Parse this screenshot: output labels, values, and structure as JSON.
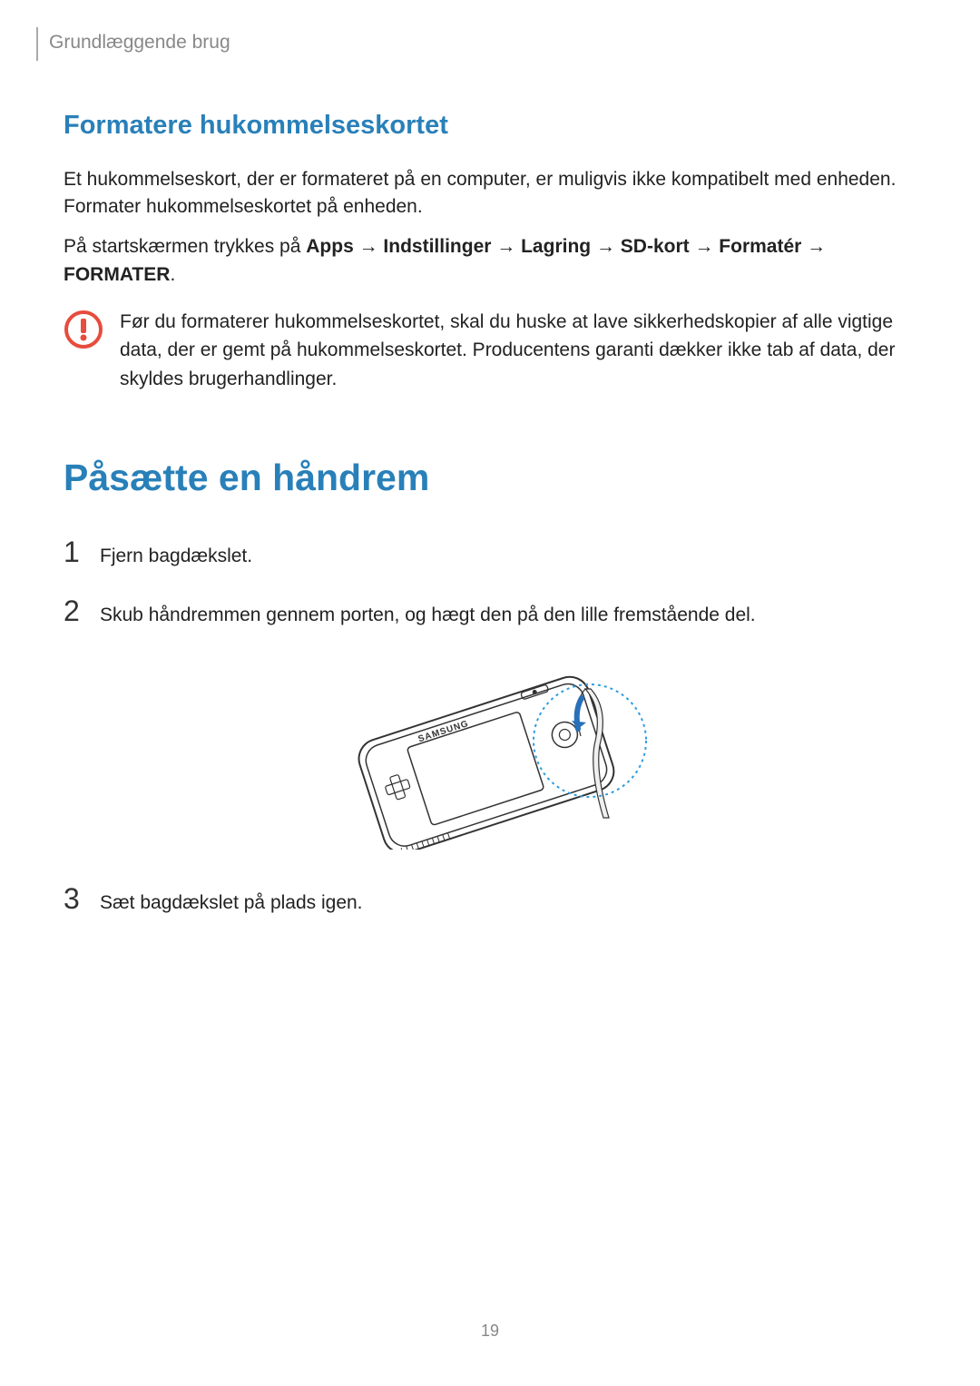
{
  "header": {
    "breadcrumb": "Grundlæggende brug"
  },
  "section1": {
    "heading": "Formatere hukommelseskortet",
    "para1": "Et hukommelseskort, der er formateret på en computer, er muligvis ikke kompatibelt med enheden. Formater hukommelseskortet på enheden.",
    "instruction_prefix": "På startskærmen trykkes på ",
    "path_apps": "Apps",
    "path_settings": "Indstillinger",
    "path_storage": "Lagring",
    "path_sdcard": "SD-kort",
    "path_formater": "Formatér",
    "path_formater_caps": "FORMATER",
    "arrow": " → ",
    "period": ".",
    "warning_text": "Før du formaterer hukommelseskortet, skal du huske at lave sikkerhedskopier af alle vigtige data, der er gemt på hukommelseskortet. Producentens garanti dækker ikke tab af data, der skyldes brugerhandlinger."
  },
  "section2": {
    "heading": "Påsætte en håndrem",
    "steps": [
      {
        "num": "1",
        "text": "Fjern bagdækslet."
      },
      {
        "num": "2",
        "text": "Skub håndremmen gennem porten, og hægt den på den lille fremstående del."
      },
      {
        "num": "3",
        "text": "Sæt bagdækslet på plads igen."
      }
    ]
  },
  "page_number": "19"
}
